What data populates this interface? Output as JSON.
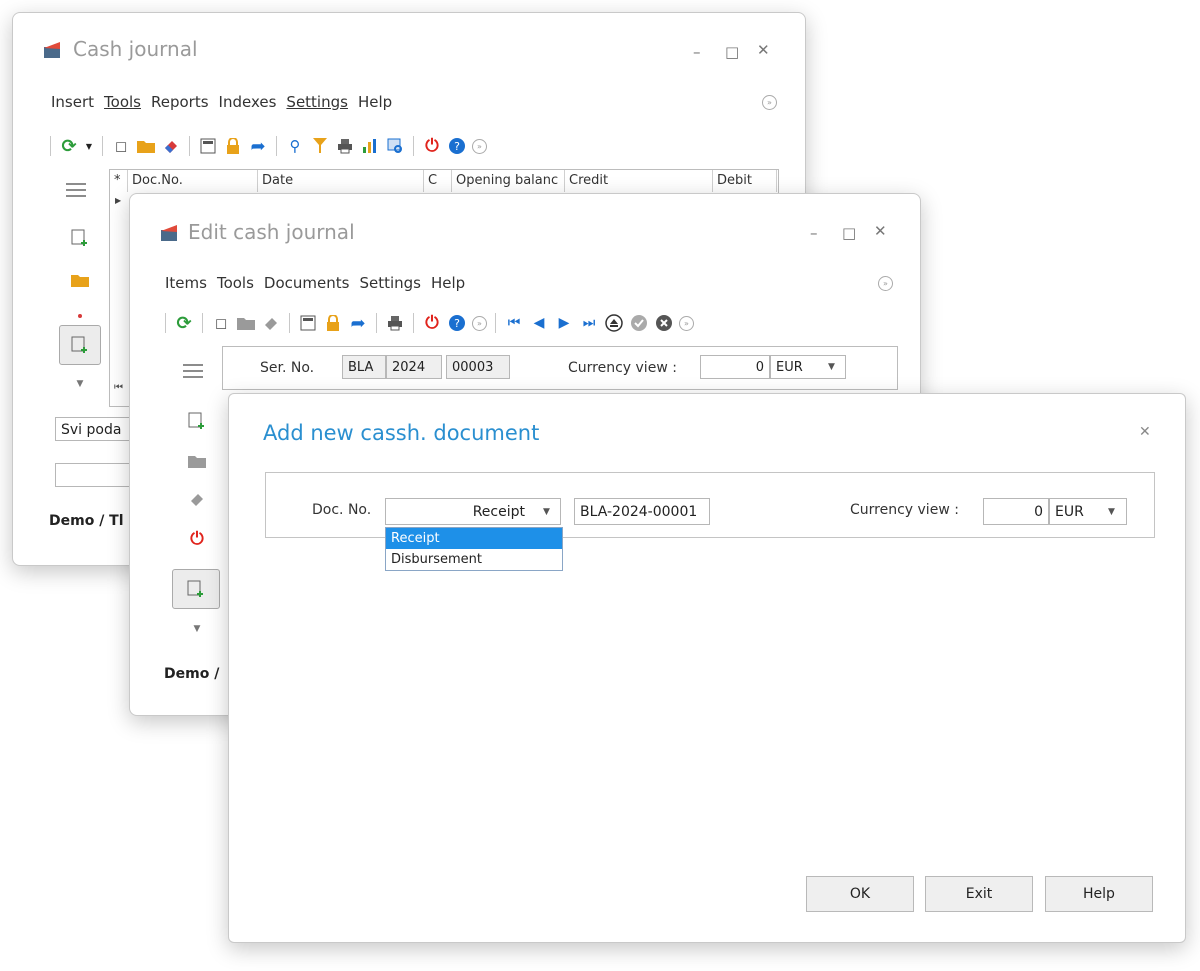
{
  "cash_journal": {
    "title": "Cash journal",
    "menu": [
      "Insert",
      "Tools",
      "Reports",
      "Indexes",
      "Settings",
      "Help"
    ],
    "columns": [
      "Doc.No.",
      "Date",
      "C",
      "Opening balanc",
      "Credit",
      "Debit"
    ],
    "filter_value": "Svi poda",
    "status": "Demo / Tl"
  },
  "edit_journal": {
    "title": "Edit cash journal",
    "menu": [
      "Items",
      "Tools",
      "Documents",
      "Settings",
      "Help"
    ],
    "ser_label": "Ser. No.",
    "ser_parts": [
      "BLA",
      "2024",
      "00003"
    ],
    "currency_label": "Currency view :",
    "currency_value": "0",
    "currency_code": "EUR",
    "status": "Demo /"
  },
  "dialog": {
    "title": "Add new cassh. document",
    "doc_label": "Doc. No.",
    "doc_type": "Receipt",
    "doc_number": "BLA-2024-00001",
    "currency_label": "Currency view :",
    "currency_value": "0",
    "currency_code": "EUR",
    "options": [
      "Receipt",
      "Disbursement"
    ],
    "buttons": {
      "ok": "OK",
      "exit": "Exit",
      "help": "Help"
    }
  },
  "colors": {
    "accent": "#1e90e8",
    "dialog_title": "#2a8fd0",
    "power": "#e0231c",
    "nav_blue": "#1a6fd0",
    "refresh_green": "#2c9c3a"
  }
}
